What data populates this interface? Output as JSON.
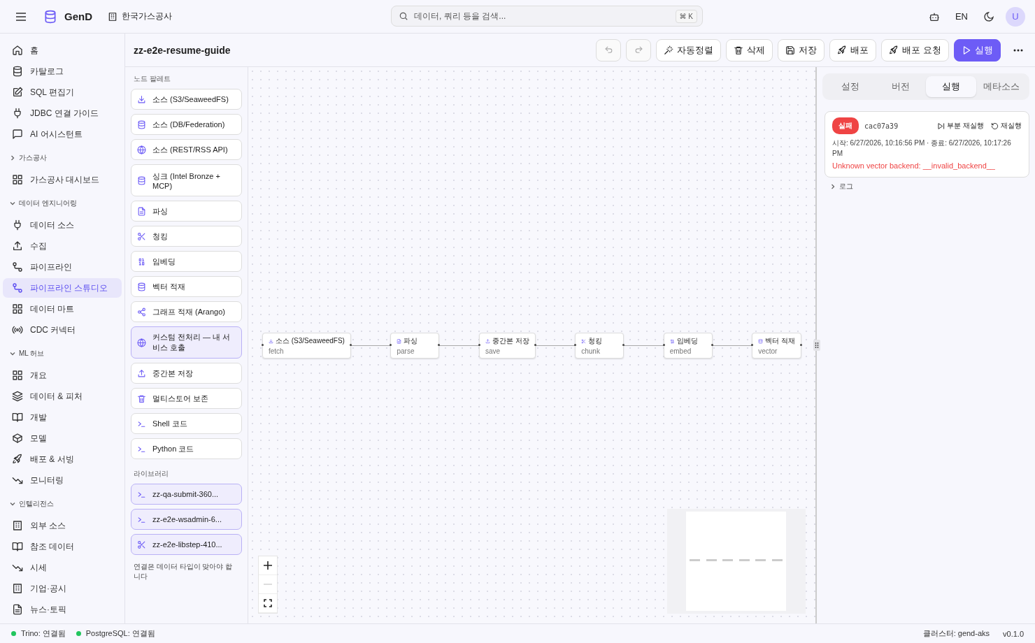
{
  "topbar": {
    "brand": "GenD",
    "org": "한국가스공사",
    "search": {
      "placeholder": "데이터, 쿼리 등을 검색...",
      "shortcut": "⌘ K"
    },
    "language": "EN",
    "avatar": "U"
  },
  "sidebar": {
    "top_items": [
      {
        "label": "홈",
        "selected": false
      },
      {
        "label": "카탈로그",
        "selected": false
      },
      {
        "label": "SQL 편집기",
        "selected": false
      },
      {
        "label": "JDBC 연결 가이드",
        "selected": false
      },
      {
        "label": "AI 어시스턴트",
        "selected": false
      }
    ],
    "groups": [
      {
        "title": "가스공사",
        "expanded": false,
        "items": [
          {
            "label": "가스공사 대시보드",
            "selected": false
          }
        ]
      },
      {
        "title": "데이터 엔지니어링",
        "expanded": true,
        "items": [
          {
            "label": "데이터 소스",
            "selected": false
          },
          {
            "label": "수집",
            "selected": false
          },
          {
            "label": "파이프라인",
            "selected": false
          },
          {
            "label": "파이프라인 스튜디오",
            "selected": true
          },
          {
            "label": "데이터 마트",
            "selected": false
          },
          {
            "label": "CDC 커넥터",
            "selected": false
          }
        ]
      },
      {
        "title": "ML 허브",
        "expanded": true,
        "items": [
          {
            "label": "개요",
            "selected": false
          },
          {
            "label": "데이터 & 피처",
            "selected": false
          },
          {
            "label": "개발",
            "selected": false
          },
          {
            "label": "모델",
            "selected": false
          },
          {
            "label": "배포 & 서빙",
            "selected": false
          },
          {
            "label": "모니터링",
            "selected": false
          }
        ]
      },
      {
        "title": "인텔리전스",
        "expanded": true,
        "items": [
          {
            "label": "외부 소스",
            "selected": false
          },
          {
            "label": "참조 데이터",
            "selected": false
          },
          {
            "label": "시세",
            "selected": false
          },
          {
            "label": "기업·공시",
            "selected": false
          },
          {
            "label": "뉴스·토픽",
            "selected": false
          }
        ]
      }
    ]
  },
  "pipeline": {
    "title": "zz-e2e-resume-guide",
    "undo": {
      "disabled": true
    },
    "redo": {
      "disabled": true
    },
    "buttons": [
      {
        "label": "자동정렬",
        "kind": "wand",
        "primary": false
      },
      {
        "label": "삭제",
        "kind": "trash",
        "primary": false
      },
      {
        "label": "저장",
        "kind": "save",
        "primary": false
      },
      {
        "label": "배포",
        "kind": "rocket",
        "primary": false
      },
      {
        "label": "배포 요청",
        "kind": "rocket",
        "primary": false
      },
      {
        "label": "실행",
        "kind": "play",
        "primary": true
      }
    ]
  },
  "palette": {
    "title": "노드 팔레트",
    "items": [
      {
        "label": "소스 (S3/SeaweedFS)",
        "kind": "download",
        "custom": false
      },
      {
        "label": "소스 (DB/Federation)",
        "kind": "database",
        "custom": false
      },
      {
        "label": "소스 (REST/RSS API)",
        "kind": "globe",
        "custom": false
      },
      {
        "label": "싱크 (Intel Bronze + MCP)",
        "kind": "database",
        "custom": false
      },
      {
        "label": "파싱",
        "kind": "file",
        "custom": false
      },
      {
        "label": "청킹",
        "kind": "scissors",
        "custom": false
      },
      {
        "label": "임베딩",
        "kind": "binary",
        "custom": false
      },
      {
        "label": "벡터 적재",
        "kind": "database",
        "custom": false
      },
      {
        "label": "그래프 적재 (Arango)",
        "kind": "share",
        "custom": false
      },
      {
        "label": "커스텀 전처리 — 내 서비스 호출",
        "kind": "globe",
        "custom": true
      },
      {
        "label": "중간본 저장",
        "kind": "upload",
        "custom": false
      },
      {
        "label": "멀티스토어 보존",
        "kind": "trash",
        "custom": false
      },
      {
        "label": "Shell 코드",
        "kind": "terminal",
        "custom": false
      },
      {
        "label": "Python 코드",
        "kind": "terminal",
        "custom": false
      }
    ],
    "library_title": "라이브러리",
    "library": [
      {
        "label": "zz-qa-submit-360...",
        "kind": "terminal"
      },
      {
        "label": "zz-e2e-wsadmin-6...",
        "kind": "terminal"
      },
      {
        "label": "zz-e2e-libstep-410...",
        "kind": "scissors"
      }
    ],
    "hint": "연결은 데이터 타입이 맞아야 합니다"
  },
  "nodes": [
    {
      "label": "소스 (S3/SeaweedFS)",
      "sublabel": "fetch",
      "kind": "download"
    },
    {
      "label": "파싱",
      "sublabel": "parse",
      "kind": "file"
    },
    {
      "label": "중간본 저장",
      "sublabel": "save",
      "kind": "upload"
    },
    {
      "label": "청킹",
      "sublabel": "chunk",
      "kind": "scissors"
    },
    {
      "label": "임베딩",
      "sublabel": "embed",
      "kind": "binary"
    },
    {
      "label": "벡터 적재",
      "sublabel": "vector",
      "kind": "database"
    }
  ],
  "panel": {
    "tabs": [
      {
        "label": "설정",
        "selected": false
      },
      {
        "label": "버전",
        "selected": false
      },
      {
        "label": "실행",
        "selected": true
      },
      {
        "label": "메타소스",
        "selected": false
      }
    ],
    "run": {
      "status": "실패",
      "id": "cac07a39",
      "actions": [
        {
          "label": "부분 재실행",
          "kind": "play-step"
        },
        {
          "label": "재실행",
          "kind": "rotate"
        }
      ],
      "time": "시작: 6/27/2026, 10:16:56 PM · 종료: 6/27/2026, 10:17:26 PM",
      "error": "Unknown vector backend: __invalid_backend__"
    },
    "log": {
      "label": "로그",
      "expanded": false
    }
  },
  "status_bar": {
    "connections": [
      {
        "label": "Trino: 연결됨",
        "color": "#22c55e"
      },
      {
        "label": "PostgreSQL: 연결됨",
        "color": "#22c55e"
      }
    ],
    "cluster": "클러스터: gend-aks",
    "version": "v0.1.0"
  }
}
